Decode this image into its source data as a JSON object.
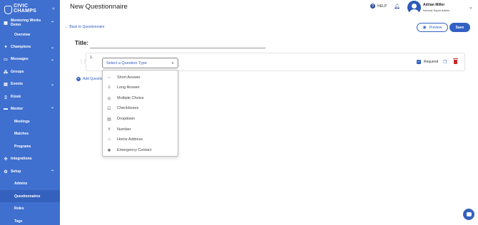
{
  "brand": {
    "line1": "CIVIC",
    "line2": "CHAMPS"
  },
  "sidebar": {
    "items": [
      {
        "label": "Mentoring Works",
        "label2": "Demo",
        "icon": "building-icon",
        "chevron": "up"
      },
      {
        "label": "Overview",
        "sub": true
      },
      {
        "label": "Champions",
        "icon": "person-icon",
        "chevron": "down"
      },
      {
        "label": "Messages",
        "icon": "chat-icon",
        "chevron": "down"
      },
      {
        "label": "Groups",
        "icon": "groups-icon"
      },
      {
        "label": "Events",
        "icon": "calendar-icon",
        "chevron": "down"
      },
      {
        "label": "Kiosk",
        "icon": "kiosk-icon"
      },
      {
        "label": "Mentor",
        "icon": "mentor-icon",
        "chevron": "up"
      },
      {
        "label": "Meetings",
        "sub": true
      },
      {
        "label": "Matches",
        "sub": true
      },
      {
        "label": "Programs",
        "sub": true
      },
      {
        "label": "Integrations",
        "icon": "puzzle-icon"
      },
      {
        "label": "Setup",
        "icon": "gear-icon",
        "chevron": "up"
      },
      {
        "label": "Admins",
        "sub": true
      },
      {
        "label": "Questionnaires",
        "sub": true,
        "active": true
      },
      {
        "label": "Roles",
        "sub": true
      },
      {
        "label": "Tags",
        "sub": true
      }
    ]
  },
  "header": {
    "title": "New Questionnaire",
    "help_label": "HELP",
    "user_name": "Adrian Miller",
    "user_role": "Internal Super Admin"
  },
  "main": {
    "back_link": "← Back to Questionnaire",
    "preview_label": "Preview",
    "save_label": "Save",
    "title_label": "Title:",
    "title_value": "",
    "question_number": "1.",
    "question_type_placeholder": "Select a Question Type",
    "required_label": "Required",
    "required_checked": true,
    "add_question_label": "Add Question"
  },
  "dropdown": {
    "options": [
      {
        "label": "Short Answer",
        "icon": "short-answer-icon"
      },
      {
        "label": "Long Answer",
        "icon": "long-answer-icon"
      },
      {
        "label": "Multiple Choice",
        "icon": "radio-check-icon"
      },
      {
        "label": "Checkboxes",
        "icon": "checkbox-icon"
      },
      {
        "label": "Dropdown",
        "icon": "dropdown-icon"
      },
      {
        "label": "Number",
        "icon": "hash-icon"
      },
      {
        "label": "Home Address",
        "icon": "home-icon"
      },
      {
        "label": "Emergency Contact",
        "icon": "emergency-icon"
      }
    ]
  },
  "colors": {
    "sidebar": "#3f6fcf",
    "accent": "#3360c4",
    "danger": "#c62828"
  }
}
